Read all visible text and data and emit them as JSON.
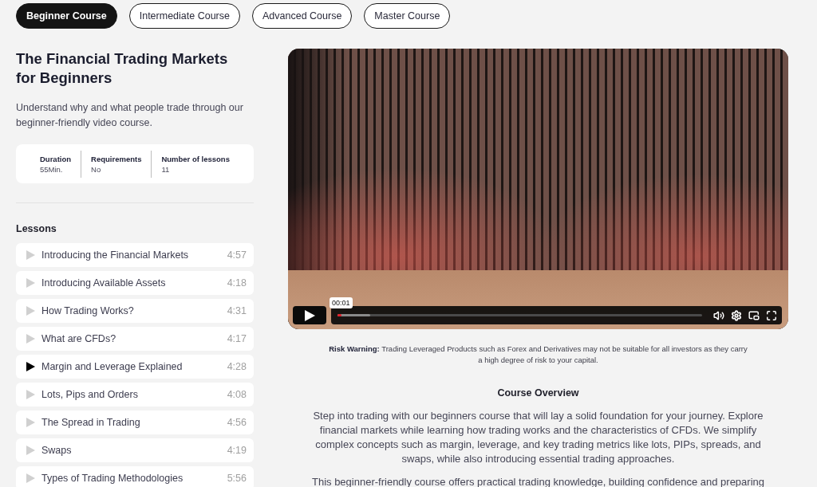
{
  "course_tabs": [
    {
      "label": "Beginner Course",
      "selected": true
    },
    {
      "label": "Intermediate Course",
      "selected": false
    },
    {
      "label": "Advanced Course",
      "selected": false
    },
    {
      "label": "Master Course",
      "selected": false
    }
  ],
  "course": {
    "title": "The Financial Trading Markets for Beginners",
    "description": "Understand why and what people trade through our beginner-friendly video course.",
    "stats": [
      {
        "label": "Duration",
        "value": "55Min."
      },
      {
        "label": "Requirements",
        "value": "No"
      },
      {
        "label": "Number of lessons",
        "value": "11"
      }
    ]
  },
  "lessons": {
    "heading": "Lessons",
    "items": [
      {
        "title": "Introducing the Financial Markets",
        "duration": "4:57",
        "selected": false
      },
      {
        "title": "Introducing Available Assets",
        "duration": "4:18",
        "selected": false
      },
      {
        "title": "How Trading Works?",
        "duration": "4:31",
        "selected": false
      },
      {
        "title": "What are CFDs?",
        "duration": "4:17",
        "selected": false
      },
      {
        "title": "Margin and Leverage Explained",
        "duration": "4:28",
        "selected": true
      },
      {
        "title": "Lots, Pips and Orders",
        "duration": "4:08",
        "selected": false
      },
      {
        "title": "The Spread in Trading",
        "duration": "4:56",
        "selected": false
      },
      {
        "title": "Swaps",
        "duration": "4:19",
        "selected": false
      },
      {
        "title": "Types of Trading Methodologies",
        "duration": "5:56",
        "selected": false
      }
    ]
  },
  "video_player": {
    "time_tooltip": "00:01",
    "progress": {
      "level": 0.01
    },
    "buffered": {
      "level": 0.09
    }
  },
  "risk_warning": "**Risk Warning:** Trading Leveraged Products such as Forex and Derivatives may not be suitable for all investors as they carry a high degree of risk to your capital.",
  "course_overview": {
    "heading": "Course Overview",
    "paragraphs": [
      "Step into trading with our beginners course that will lay a solid foundation for your journey. Explore financial markets while learning how trading works and the characteristics of CFDs. We simplify complex concepts such as margin, leverage, and key trading metrics like lots, PIPs, spreads, and swaps, while also introducing essential trading approaches.",
      "This beginner-friendly course offers practical trading knowledge, building confidence and preparing"
    ]
  }
}
